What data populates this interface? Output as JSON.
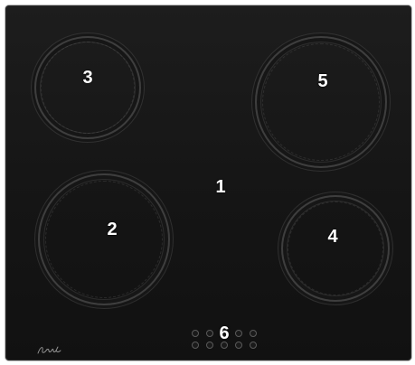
{
  "labels": {
    "zone_3": "3",
    "zone_5": "5",
    "panel_1": "1",
    "zone_2": "2",
    "zone_4": "4",
    "controls_6": "6"
  },
  "colors": {
    "surface": "#151515",
    "ring": "#3e3e3e",
    "label": "#ffffff"
  },
  "icons": {
    "logo": "brand-logo-script"
  }
}
